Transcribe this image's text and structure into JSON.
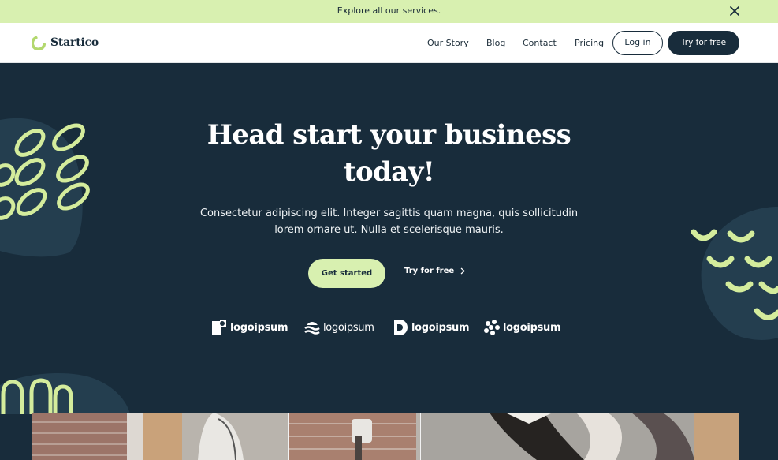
{
  "announcement": {
    "text": "Explore all our services.",
    "close_icon": "close-icon"
  },
  "brand": {
    "name": "Startico",
    "accent": "#c7e68c",
    "dark": "#182c3b"
  },
  "nav": {
    "links": [
      "Our Story",
      "Blog",
      "Contact",
      "Pricing"
    ],
    "login_label": "Log in",
    "cta_label": "Try for free"
  },
  "hero": {
    "title": "Head start your business today!",
    "subtitle": "Consectetur adipiscing elit. Integer sagittis quam magna, quis sollicitudin lorem ornare ut. Nulla et scelerisque mauris.",
    "primary_cta": "Get started",
    "secondary_cta": "Try for free",
    "secondary_icon": "chevron-right-icon"
  },
  "logos": [
    "logoipsum",
    "logoipsum",
    "logoipsum",
    "logoipsum"
  ],
  "colors": {
    "hero_bg": "#182c3b",
    "announce_bg": "#d8f0b0",
    "blob": "#243e4f",
    "lime": "#d4ec9c"
  }
}
